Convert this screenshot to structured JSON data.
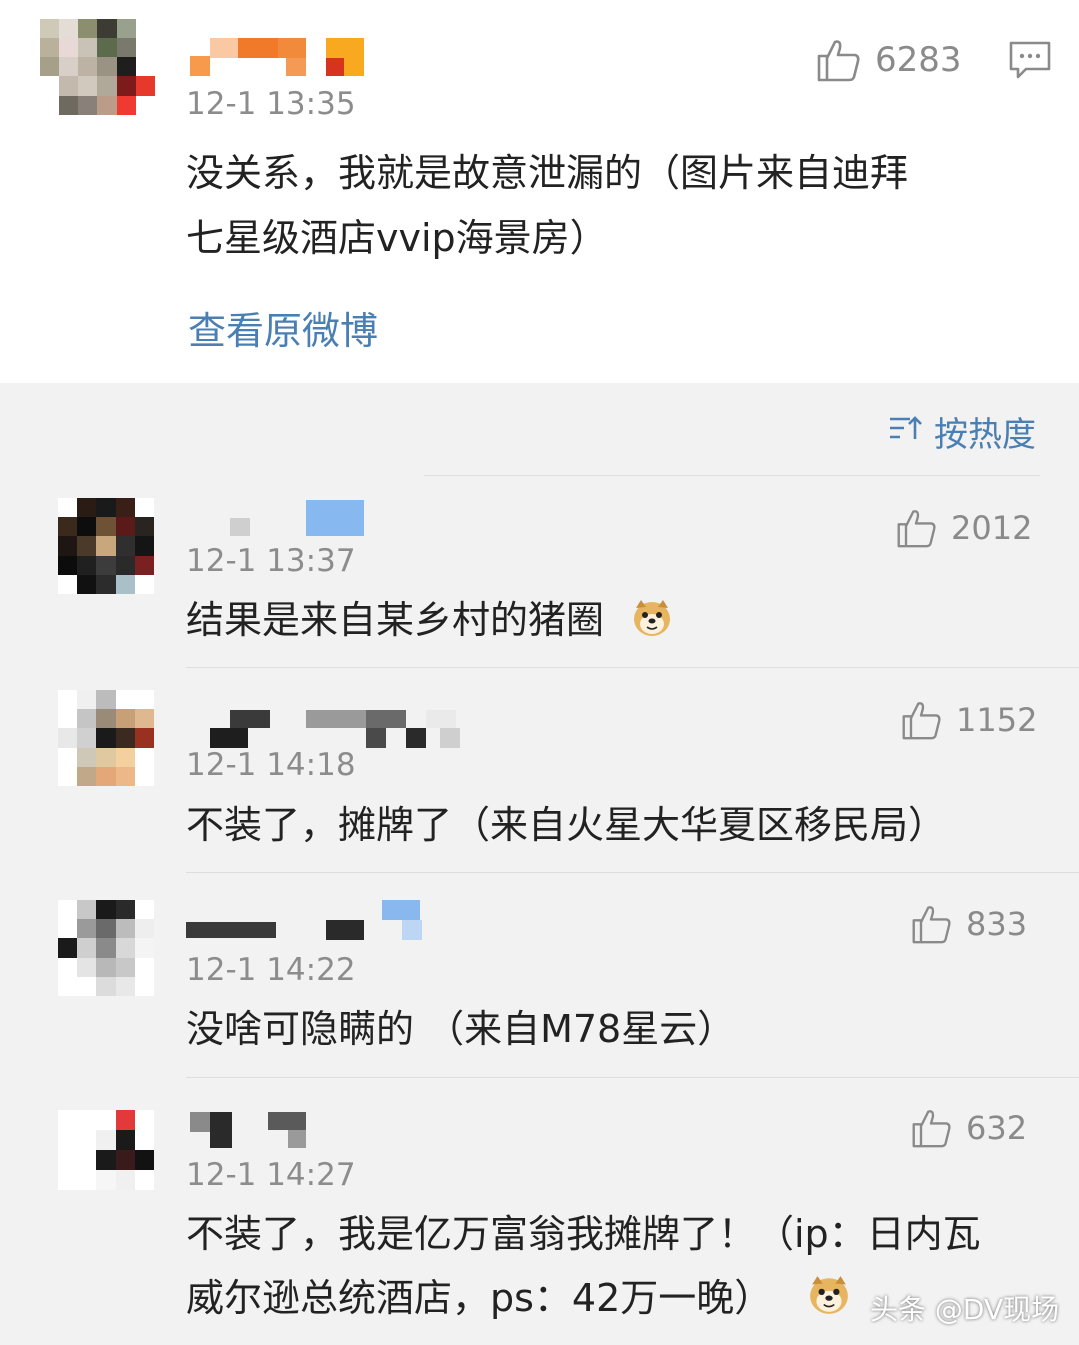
{
  "post": {
    "time": "12-1 13:35",
    "likes": "6283",
    "text_line1": "没关系，我就是故意泄漏的（图片来自迪拜",
    "text_line2": "七星级酒店vvip海景房）",
    "view_original": "查看原微博"
  },
  "sort": {
    "label": "按热度"
  },
  "comments": [
    {
      "time": "12-1 13:37",
      "likes": "2012",
      "text": "结果是来自某乡村的猪圈"
    },
    {
      "time": "12-1 14:18",
      "likes": "1152",
      "text": "不装了，摊牌了（来自火星大华夏区移民局）"
    },
    {
      "time": "12-1 14:22",
      "likes": "833",
      "text": "没啥可隐瞒的 （来自M78星云）"
    },
    {
      "time": "12-1 14:27",
      "likes": "632",
      "text_line1": "不装了，我是亿万富翁我摊牌了！（ip：日内瓦",
      "text_line2": "威尔逊总统酒店，ps：42万一晚）"
    }
  ],
  "watermark": "头条 @DV现场",
  "colors": {
    "link": "#4a7fb3",
    "time": "#8c8c8c",
    "text": "#222222",
    "background": "#f2f2f2"
  },
  "icons": [
    "thumbs-up-icon",
    "comment-icon",
    "sort-icon",
    "doge-emoji"
  ]
}
